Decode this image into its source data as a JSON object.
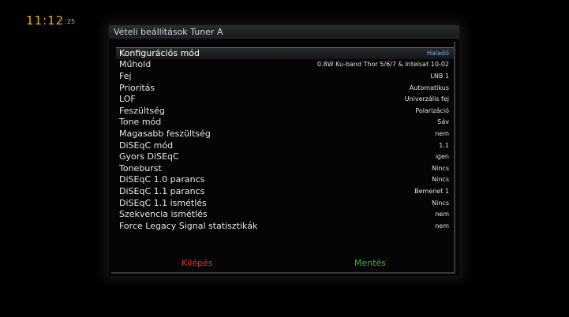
{
  "clock": {
    "time": "11:12",
    "seconds": ":25"
  },
  "window": {
    "title": "Vételi beállítások Tuner A"
  },
  "settings": [
    {
      "label": "Konfigurációs mód",
      "value": "Haladó",
      "selected": true
    },
    {
      "label": "Műhold",
      "value": "0.8W Ku-band Thor 5/6/7 & Intelsat 10-02"
    },
    {
      "label": "Fej",
      "value": "LNB 1"
    },
    {
      "label": "Prioritás",
      "value": "Automatikus"
    },
    {
      "label": "LOF",
      "value": "Univerzális fej"
    },
    {
      "label": "Feszültség",
      "value": "Polarizáció"
    },
    {
      "label": "Tone mód",
      "value": "Sáv"
    },
    {
      "label": "Magasabb feszültség",
      "value": "nem"
    },
    {
      "label": "DiSEqC mód",
      "value": "1.1"
    },
    {
      "label": "Gyors DiSEqC",
      "value": "igen"
    },
    {
      "label": "Toneburst",
      "value": "Nincs"
    },
    {
      "label": "DiSEqC 1.0 parancs",
      "value": "Nincs"
    },
    {
      "label": "DiSEqC 1.1 parancs",
      "value": "Bemenet 1"
    },
    {
      "label": "DiSEqC 1.1 ismétlés",
      "value": "Nincs"
    },
    {
      "label": "Szekvencia ismétlés",
      "value": "nem"
    },
    {
      "label": "Force Legacy Signal statisztikák",
      "value": "nem"
    }
  ],
  "buttons": {
    "red_label": "Kilépés",
    "green_label": "Mentés"
  },
  "colors": {
    "clock": "#e8b400",
    "red": "#e0322c",
    "green": "#3db33a",
    "selected_value": "#7aa8d8"
  }
}
